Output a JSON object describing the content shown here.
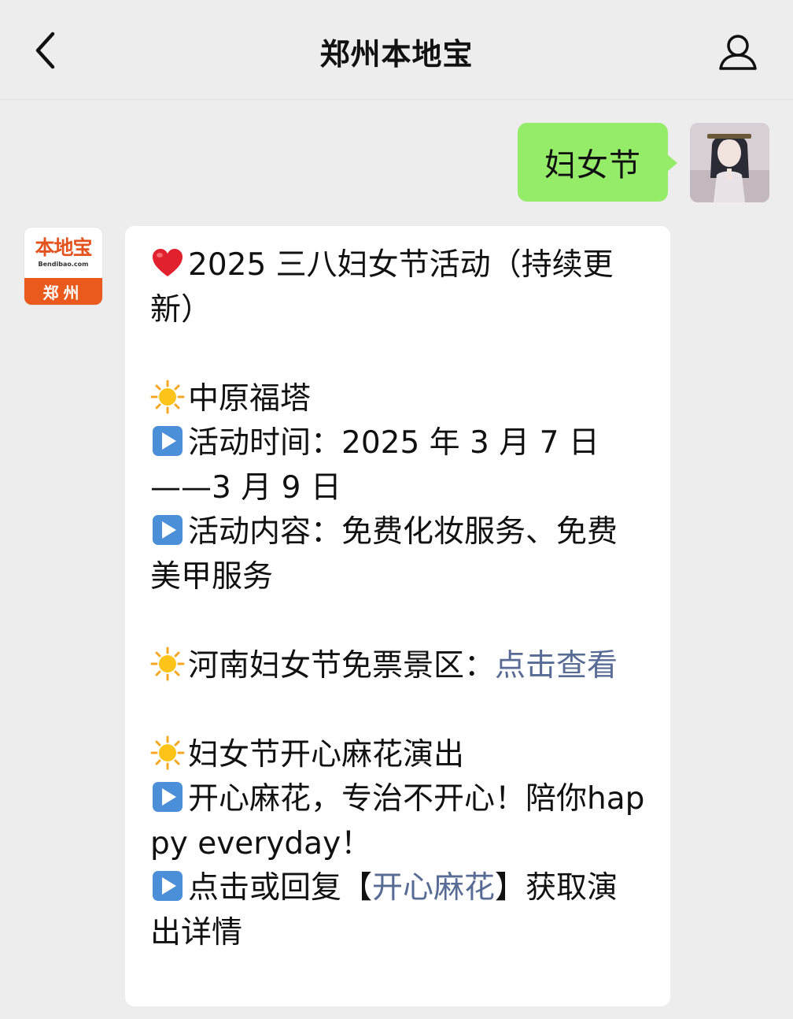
{
  "header": {
    "title": "郑州本地宝",
    "back_icon": "chevron-left-icon",
    "profile_icon": "person-icon"
  },
  "outgoing": {
    "text": "妇女节"
  },
  "incoming": {
    "avatar": {
      "logo_main": "本地宝",
      "logo_sub": "Bendibao.com",
      "logo_city": "郑州"
    },
    "heading": "2025 三八妇女节活动（持续更新）",
    "section1": {
      "title": "中原福塔",
      "time": "活动时间：2025 年 3 月 7 日——3 月 9 日",
      "content": "活动内容：免费化妆服务、免费美甲服务"
    },
    "section2": {
      "title": "河南妇女节免票景区：",
      "link": "点击查看"
    },
    "section3": {
      "title": "妇女节开心麻花演出",
      "line1": "开心麻花，专治不开心！陪你happy everyday！",
      "reply_prefix": "点击或回复【",
      "reply_link": "开心麻花",
      "reply_suffix": "】获取演出详情"
    }
  },
  "colors": {
    "background": "#ededed",
    "outgoing_bubble": "#95ec69",
    "incoming_bubble": "#ffffff",
    "link": "#576b95",
    "brand_orange": "#ea5a1c"
  }
}
